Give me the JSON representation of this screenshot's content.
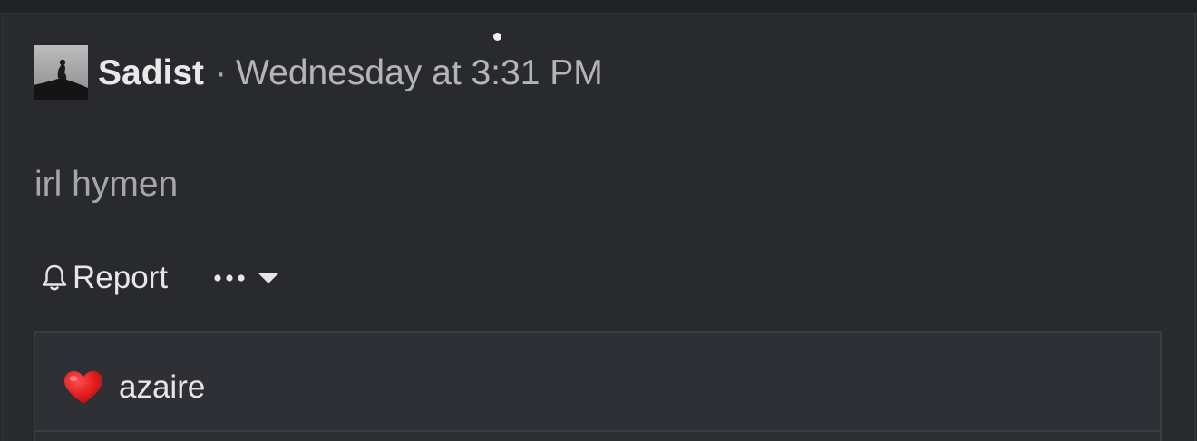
{
  "post": {
    "author": "Sadist",
    "separator": "·",
    "timestamp": "Wednesday at 3:31 PM",
    "message": "irl hymen"
  },
  "actions": {
    "report_label": "Report",
    "icons": [
      "bell-icon",
      "ellipsis-icon",
      "caret-down-icon"
    ]
  },
  "reactions": {
    "icon": "heart-icon",
    "users": [
      "azaire"
    ]
  },
  "colors": {
    "background": "#27282c",
    "reactions_panel": "#2f3035",
    "heart": "#e01b1b"
  }
}
